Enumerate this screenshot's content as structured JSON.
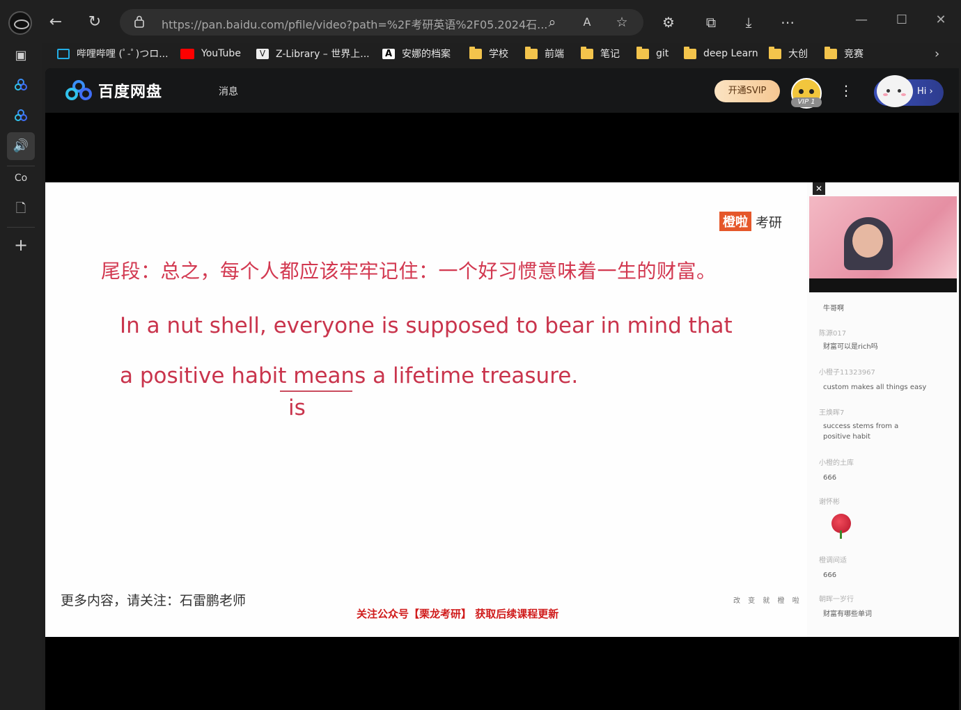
{
  "browser": {
    "url": "https://pan.baidu.com/pfile/video?path=%2F考研英语%2F05.2024石...",
    "bookmarks": [
      {
        "label": "哔哩哔哩 (ﾟ-ﾟ)つロ..."
      },
      {
        "label": "YouTube"
      },
      {
        "label": "Z-Library – 世界上..."
      },
      {
        "label": "安娜的档案"
      },
      {
        "label": "学校"
      },
      {
        "label": "前端"
      },
      {
        "label": "笔记"
      },
      {
        "label": "git"
      },
      {
        "label": "deep Learn"
      },
      {
        "label": "大创"
      },
      {
        "label": "竞赛"
      }
    ],
    "sidebar_text_item": "Co"
  },
  "pan": {
    "logo_text": "百度网盘",
    "messages_label": "消息",
    "svip_button": "开通SVIP",
    "vip_badge": "VIP 1",
    "hi_label": "Hi ›"
  },
  "slide": {
    "brand_box": "橙啦",
    "brand_text": "考研",
    "chinese_line": "尾段：总之，每个人都应该牢牢记住：一个好习惯意味着一生的财富。",
    "english_line_1": "In a nut shell, everyone is supposed to bear in mind that",
    "english_line_2": "a positive habit means a lifetime treasure.",
    "annotation": "is",
    "footer_left": "更多内容，请关注：石雷鹏老师",
    "footer_mid": "关注公众号【栗龙考研】 获取后续课程更新",
    "footer_right": "改 变 就 橙 啦"
  },
  "chat": {
    "messages": [
      {
        "user": "",
        "text": "牛哥啊"
      },
      {
        "user": "陈源017",
        "text": "财富可以是rich吗"
      },
      {
        "user": "小橙子11323967",
        "text": "custom makes all things easy"
      },
      {
        "user": "王焕晖7",
        "text": "success stems from a positive habit"
      },
      {
        "user": "小橙的土库",
        "text": "666"
      },
      {
        "user": "谢怀彬",
        "text": ""
      },
      {
        "user": "橙调间适",
        "text": "666"
      },
      {
        "user": "朝晖一岁行",
        "text": "财富有哪些单词"
      }
    ]
  }
}
